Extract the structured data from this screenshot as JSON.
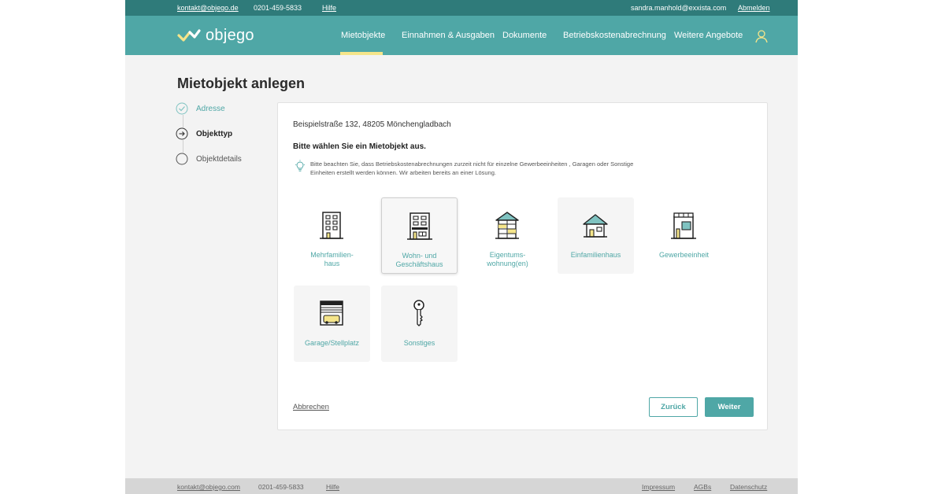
{
  "topbar": {
    "email": "kontakt@objego.de",
    "phone": "0201-459-5833",
    "help": "Hilfe",
    "user_email": "sandra.manhold@exxista.com",
    "logout": "Abmelden"
  },
  "nav": {
    "logo_text": "objego",
    "items": [
      "Mietobjekte",
      "Einnahmen & Ausgaben",
      "Dokumente",
      "Betriebskostenabrechnung",
      "Weitere Angebote"
    ],
    "active": "Mietobjekte",
    "user_icon": "user-icon"
  },
  "page": {
    "title": "Mietobjekt anlegen"
  },
  "steps": [
    {
      "label": "Adresse",
      "state": "done",
      "icon": "check-circle-icon"
    },
    {
      "label": "Objekttyp",
      "state": "current",
      "icon": "arrow-circle-icon"
    },
    {
      "label": "Objektdetails",
      "state": "todo",
      "icon": "empty-circle-icon"
    }
  ],
  "card": {
    "address": "Beispielstraße 132, 48205 Mönchengladbach",
    "prompt": "Bitte wählen Sie ein Mietobjekt aus.",
    "hint": "Bitte beachten Sie, dass Betriebskostenabrechnungen zurzeit nicht für einzelne Gewerbeeinheiten , Garagen oder Sonstige Einheiten erstellt werden können. Wir arbeiten bereits an einer Lösung.",
    "hint_icon": "lightbulb-icon",
    "types": [
      {
        "label": "Mehrfamilien-\nhaus",
        "icon": "apartment-building-icon"
      },
      {
        "label": "Wohn- und Geschäftshaus",
        "icon": "mixed-use-building-icon",
        "selected": true
      },
      {
        "label": "Eigentums-\nwohnung(en)",
        "icon": "condo-building-icon"
      },
      {
        "label": "Einfamilienhaus",
        "icon": "house-icon"
      },
      {
        "label": "Gewerbeeinheit",
        "icon": "shop-icon"
      },
      {
        "label": "Garage/Stellplatz",
        "icon": "garage-icon"
      },
      {
        "label": "Sonstiges",
        "icon": "key-icon"
      }
    ],
    "cancel_label": "Abbrechen",
    "back_label": "Zurück",
    "next_label": "Weiter"
  },
  "footer": {
    "email": "kontakt@objego.com",
    "phone": "0201-459-5833",
    "help": "Hilfe",
    "impressum": "Impressum",
    "agbs": "AGBs",
    "privacy": "Datenschutz"
  },
  "colors": {
    "teal": "#4fa7a6",
    "teal_dark": "#2f7b7a",
    "accent_yellow": "#f5e58a",
    "background": "#f3f3f3"
  }
}
